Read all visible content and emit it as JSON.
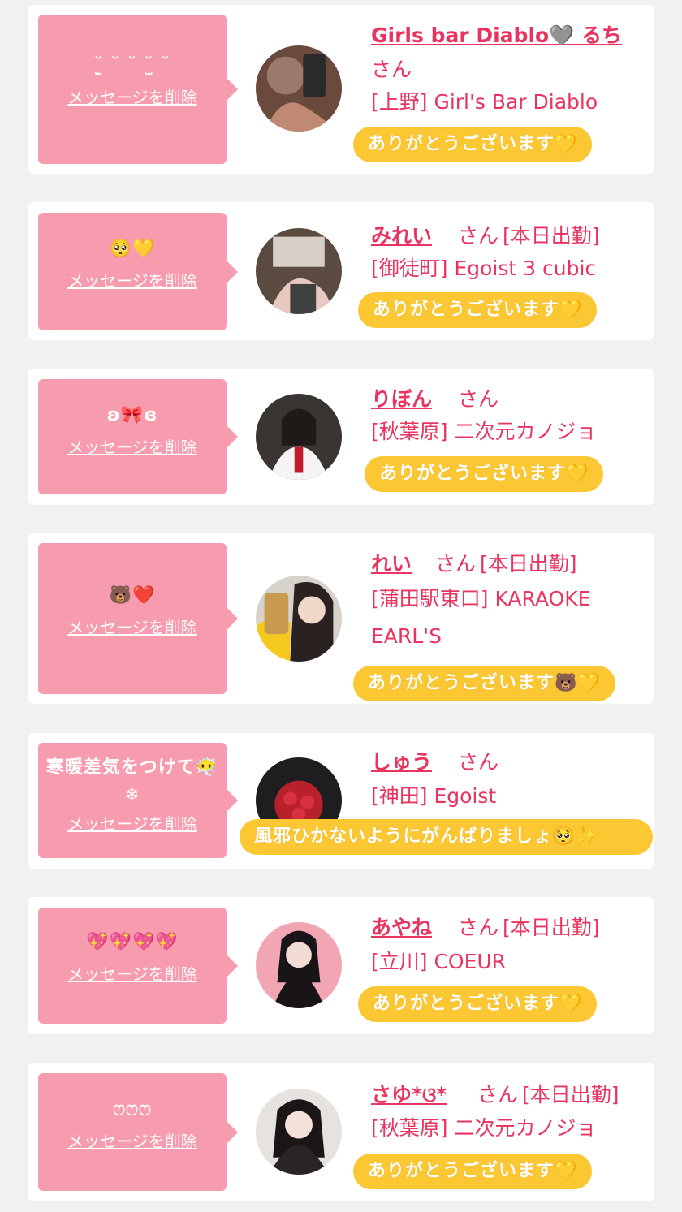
{
  "delete_label": "メッセージを削除",
  "honorific": "さん",
  "items": [
    {
      "message": "˘̫ ˘ ˘ ˘̫ ˘",
      "name": "Girls bar Diablo🩶 るち",
      "status": "",
      "shop": "[上野] Girl's Bar Diablo",
      "reply": "ありがとうございます💛"
    },
    {
      "message": "🥺💛",
      "name": "みれい",
      "status": "[本日出勤]",
      "shop": "[御徒町] Egoist 3 cubic",
      "reply": "ありがとうございます💛"
    },
    {
      "message": "ʚ🎀ɞ",
      "name": "りぼん",
      "status": "",
      "shop": "[秋葉原] 二次元カノジョ",
      "reply": "ありがとうございます💛"
    },
    {
      "message": "🐻❤️",
      "name": "れい",
      "status": "[本日出勤]",
      "shop": "[蒲田駅東口] KARAOKE EARL'S",
      "reply": "ありがとうございます🐻💛"
    },
    {
      "message": "寒暖差気をつけて😶‍🌫️❄",
      "name": "しゅう",
      "status": "",
      "shop": "[神田] Egoist",
      "reply": "風邪ひかないようにがんばりましょ🥺✨"
    },
    {
      "message": "💖💖💖💖",
      "name": "あやね",
      "status": "[本日出勤]",
      "shop": "[立川] COEUR",
      "reply": "ありがとうございます💛"
    },
    {
      "message": "ෆෆෆ",
      "name": "さゆ*ଓ*",
      "status": "[本日出勤]",
      "shop": "[秋葉原] 二次元カノジョ",
      "reply": "ありがとうございます💛"
    }
  ],
  "colors": {
    "bubble": "#f79cae",
    "accent": "#e8345f",
    "reply_bg": "#fbc732",
    "card_bg": "#ffffff",
    "page_bg": "#f1f1f1"
  }
}
